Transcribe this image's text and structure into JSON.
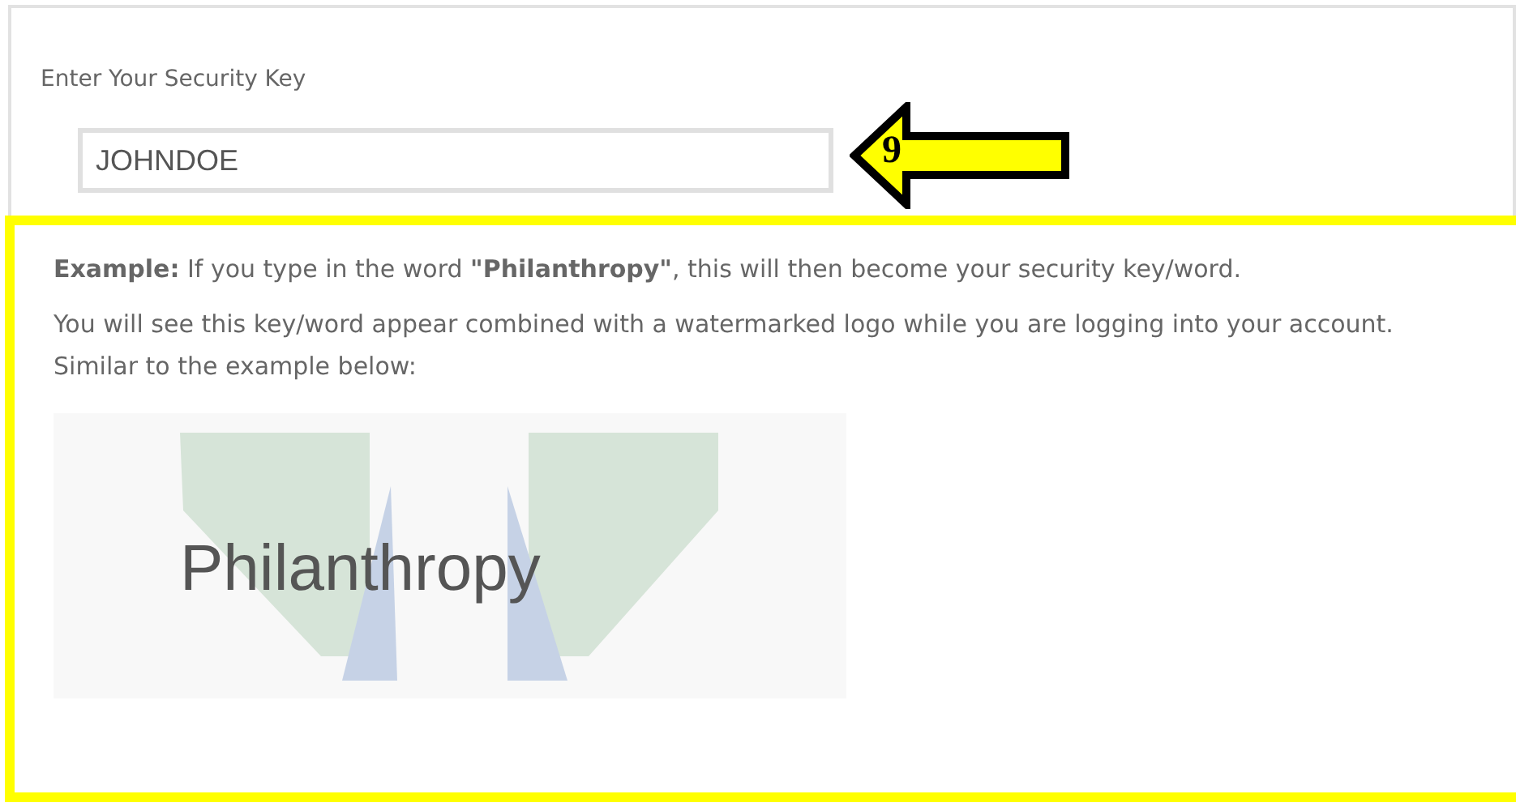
{
  "security_key": {
    "label": "Enter Your Security Key",
    "value": "JOHNDOE"
  },
  "callout": {
    "number": "9"
  },
  "example": {
    "paragraphs": [
      "**Example:** If you type in the word **\"Philanthropy\"**, this will then become your security key/word.",
      "You will see this key/word appear combined with a watermarked logo while you are logging into your account. Similar to the example below:"
    ],
    "image_word": "Philanthropy"
  }
}
